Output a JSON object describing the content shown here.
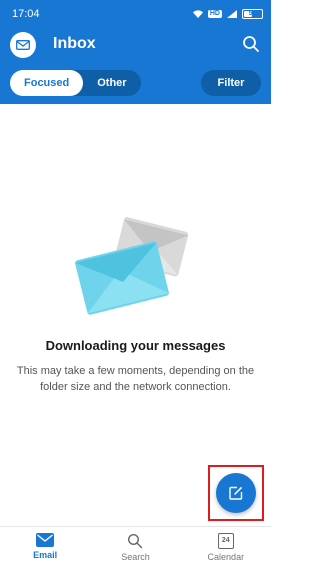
{
  "status_bar": {
    "time": "17:04",
    "network_badge": "HD",
    "battery": "53",
    "battery_percent": 53
  },
  "header": {
    "title": "Inbox"
  },
  "tabs": [
    {
      "label": "Focused",
      "active": true
    },
    {
      "label": "Other",
      "active": false
    }
  ],
  "filter": {
    "label": "Filter"
  },
  "empty_state": {
    "title": "Downloading your messages",
    "body": "This may take a few moments, depending on the folder size and the network connection."
  },
  "bottom_nav": [
    {
      "label": "Email",
      "icon": "mail-icon",
      "active": true
    },
    {
      "label": "Search",
      "icon": "search-icon",
      "active": false
    },
    {
      "label": "Calendar",
      "icon": "calendar-icon",
      "active": false,
      "icon_text": "24"
    }
  ],
  "colors": {
    "brand": "#1877d2",
    "highlight": "#e01b1b"
  }
}
